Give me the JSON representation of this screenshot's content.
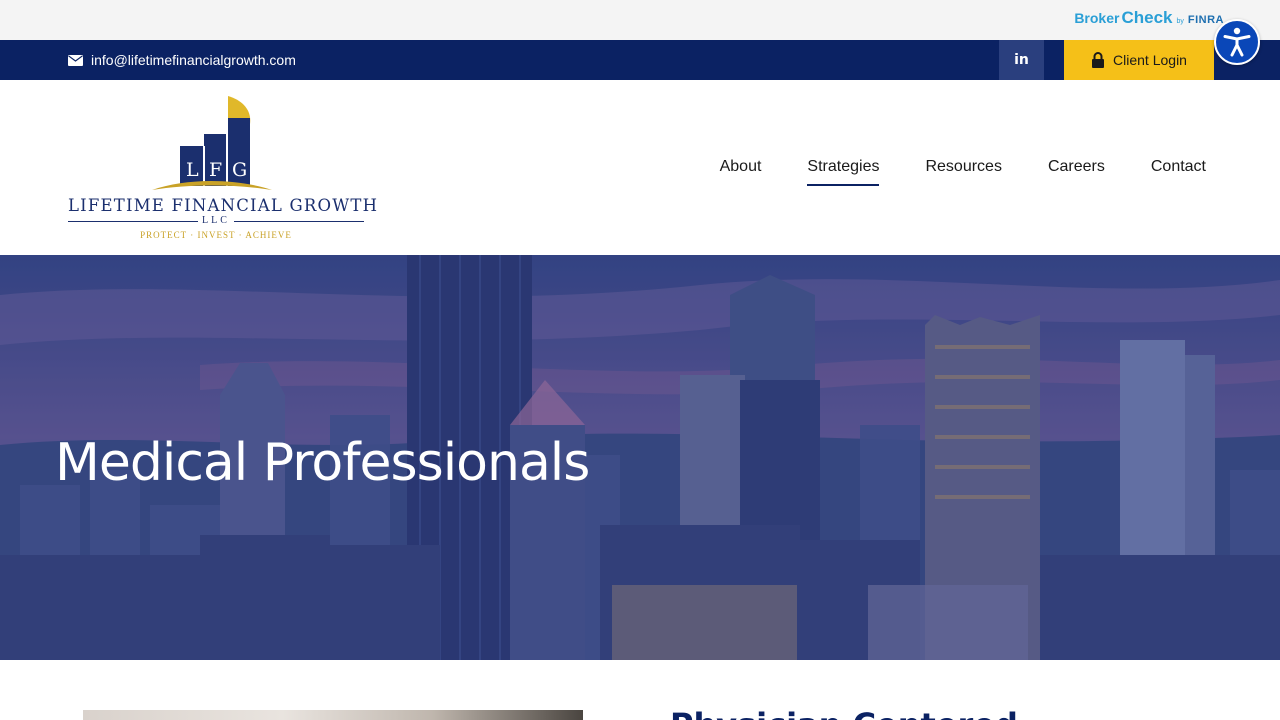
{
  "utility_bar": {
    "brokercheck": {
      "broker": "Broker",
      "check": "Check",
      "by": "by",
      "finra": "FINRA"
    }
  },
  "contact_bar": {
    "email": "info@lifetimefinancialgrowth.com",
    "linkedin": "in",
    "client_login": "Client Login"
  },
  "logo": {
    "monogram": "LFG",
    "name": "LIFETIME FINANCIAL GROWTH",
    "suffix": "LLC",
    "tagline": "PROTECT · INVEST · ACHIEVE"
  },
  "nav": {
    "items": [
      {
        "label": "About"
      },
      {
        "label": "Strategies",
        "active": true
      },
      {
        "label": "Resources"
      },
      {
        "label": "Careers"
      },
      {
        "label": "Contact"
      }
    ]
  },
  "hero": {
    "title": "Medical Professionals"
  },
  "content": {
    "heading": "Physician Centered"
  },
  "colors": {
    "navy": "#0b2263",
    "gold": "#f5c018",
    "accessibility_blue": "#0a47b8"
  }
}
